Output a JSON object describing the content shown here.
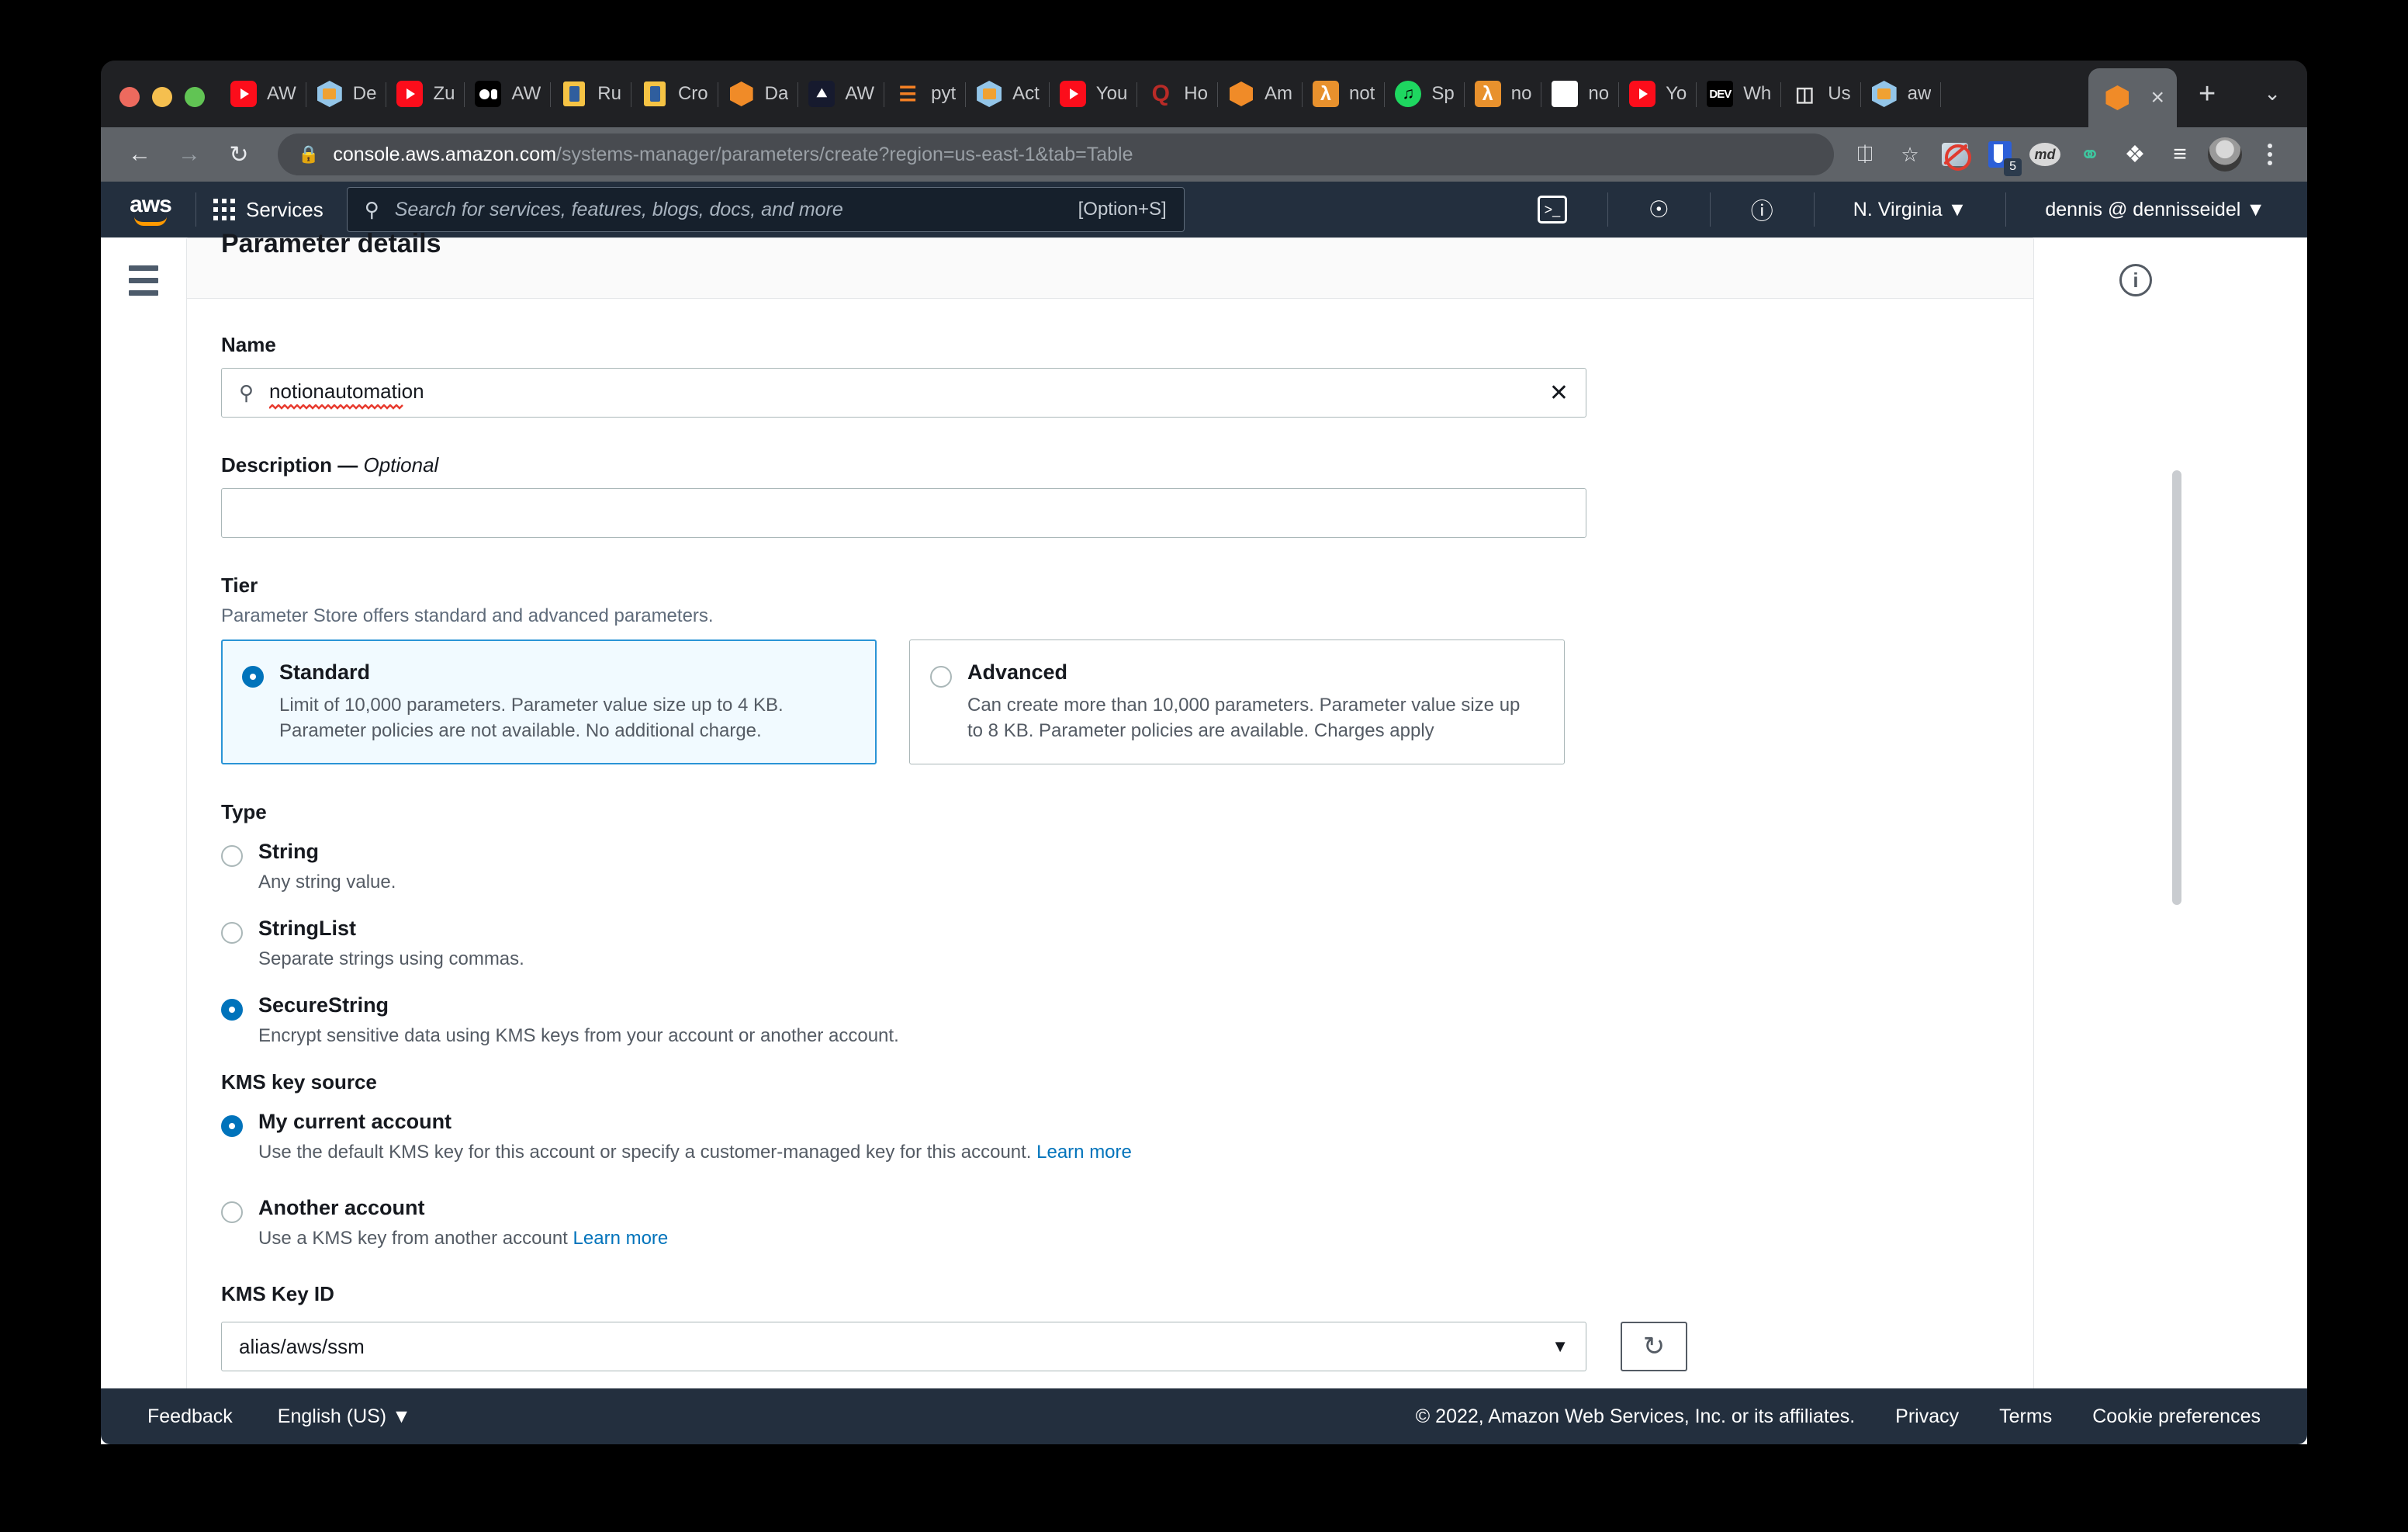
{
  "browser": {
    "tabs": [
      {
        "label": "AW",
        "icon": "youtube-icon",
        "kind": "yt"
      },
      {
        "label": "De",
        "icon": "aws-console-icon",
        "kind": "aws"
      },
      {
        "label": "Zu",
        "icon": "youtube-icon",
        "kind": "yt"
      },
      {
        "label": "AW",
        "icon": "video-record-icon",
        "kind": "vid"
      },
      {
        "label": "Ru",
        "icon": "document-box-icon",
        "kind": "box"
      },
      {
        "label": "Cro",
        "icon": "document-box-icon",
        "kind": "box"
      },
      {
        "label": "Da",
        "icon": "orange-cube-icon",
        "kind": "cube"
      },
      {
        "label": "AW",
        "icon": "flame-icon",
        "kind": "dark"
      },
      {
        "label": "pyt",
        "icon": "stackoverflow-icon",
        "kind": "py"
      },
      {
        "label": "Act",
        "icon": "aws-console-icon",
        "kind": "aws"
      },
      {
        "label": "You",
        "icon": "youtube-icon",
        "kind": "yt"
      },
      {
        "label": "Ho",
        "icon": "quora-icon",
        "kind": "q"
      },
      {
        "label": "Am",
        "icon": "orange-cube-icon",
        "kind": "cube"
      },
      {
        "label": "not",
        "icon": "lambda-icon",
        "kind": "lambda"
      },
      {
        "label": "Sp",
        "icon": "spotify-icon",
        "kind": "spotify"
      },
      {
        "label": "no",
        "icon": "lambda-icon",
        "kind": "lambda"
      },
      {
        "label": "no",
        "icon": "white-cube-icon",
        "kind": "white"
      },
      {
        "label": "Yo",
        "icon": "youtube-icon",
        "kind": "yt"
      },
      {
        "label": "Wh",
        "icon": "devto-icon",
        "kind": "dev"
      },
      {
        "label": "Us",
        "icon": "wireframe-cube-icon",
        "kind": "wire"
      },
      {
        "label": "aw",
        "icon": "aws-console-icon",
        "kind": "aws"
      }
    ],
    "active_tab": {
      "label": "",
      "icon": "orange-cube-icon",
      "close_label": "×"
    },
    "new_tab_label": "+",
    "tab_list_label": "⌄",
    "nav": {
      "back": "←",
      "forward": "→",
      "reload": "↻"
    },
    "url": {
      "lock_icon": "lock-icon",
      "domain": "console.aws.amazon.com",
      "path": "/systems-manager/parameters/create?region=us-east-1&tab=Table"
    },
    "toolbar_icons": [
      {
        "name": "share-icon",
        "glyph": "⤴"
      },
      {
        "name": "bookmark-star-icon",
        "glyph": "☆"
      },
      {
        "name": "noscript-extension-icon",
        "glyph": ""
      },
      {
        "name": "pocket-extension-icon",
        "glyph": "",
        "badge": "5"
      },
      {
        "name": "markdown-extension-icon",
        "glyph": "md"
      },
      {
        "name": "evernote-extension-icon",
        "glyph": "Ѳ"
      },
      {
        "name": "extensions-puzzle-icon",
        "glyph": "❖"
      },
      {
        "name": "playlist-icon",
        "glyph": "☰"
      },
      {
        "name": "profile-avatar",
        "glyph": ""
      },
      {
        "name": "chrome-menu-icon",
        "glyph": ""
      }
    ]
  },
  "aws_nav": {
    "logo": "aws",
    "services_label": "Services",
    "search_placeholder": "Search for services, features, blogs, docs, and more",
    "search_shortcut": "[Option+S]",
    "cloudshell_icon": "cloudshell-icon",
    "notifications_icon": "bell-icon",
    "help_icon": "help-circle-icon",
    "region": "N. Virginia",
    "region_caret": "▼",
    "account": "dennis @ dennisseidel",
    "account_caret": "▼"
  },
  "form": {
    "card_title": "Parameter details",
    "name": {
      "label": "Name",
      "value": "notionautomation",
      "search_icon": "search-icon",
      "clear_icon": "clear-x-icon"
    },
    "description": {
      "label": "Description — ",
      "optional": "Optional",
      "value": "",
      "placeholder": ""
    },
    "tier": {
      "label": "Tier",
      "hint": "Parameter Store offers standard and advanced parameters.",
      "options": [
        {
          "title": "Standard",
          "desc": "Limit of 10,000 parameters. Parameter value size up to 4 KB. Parameter policies are not available. No additional charge.",
          "selected": true
        },
        {
          "title": "Advanced",
          "desc": "Can create more than 10,000 parameters. Parameter value size up to 8 KB. Parameter policies are available. Charges apply",
          "selected": false
        }
      ]
    },
    "type": {
      "label": "Type",
      "options": [
        {
          "title": "String",
          "desc": "Any string value.",
          "selected": false
        },
        {
          "title": "StringList",
          "desc": "Separate strings using commas.",
          "selected": false
        },
        {
          "title": "SecureString",
          "desc": "Encrypt sensitive data using KMS keys from your account or another account.",
          "selected": true
        }
      ]
    },
    "kms_key_source": {
      "label": "KMS key source",
      "options": [
        {
          "title": "My current account",
          "desc": "Use the default KMS key for this account or specify a customer-managed key for this account.",
          "link": "Learn more",
          "selected": true
        },
        {
          "title": "Another account",
          "desc": "Use a KMS key from another account",
          "link": "Learn more",
          "selected": false
        }
      ]
    },
    "kms_key_id": {
      "label": "KMS Key ID",
      "value": "alias/aws/ssm",
      "caret": "▼",
      "refresh_icon": "refresh-icon"
    }
  },
  "info_icon": "info-circle-icon",
  "footer": {
    "feedback": "Feedback",
    "language": "English (US)",
    "language_caret": "▼",
    "copyright": "© 2022, Amazon Web Services, Inc. or its affiliates.",
    "privacy": "Privacy",
    "terms": "Terms",
    "cookies": "Cookie preferences"
  }
}
